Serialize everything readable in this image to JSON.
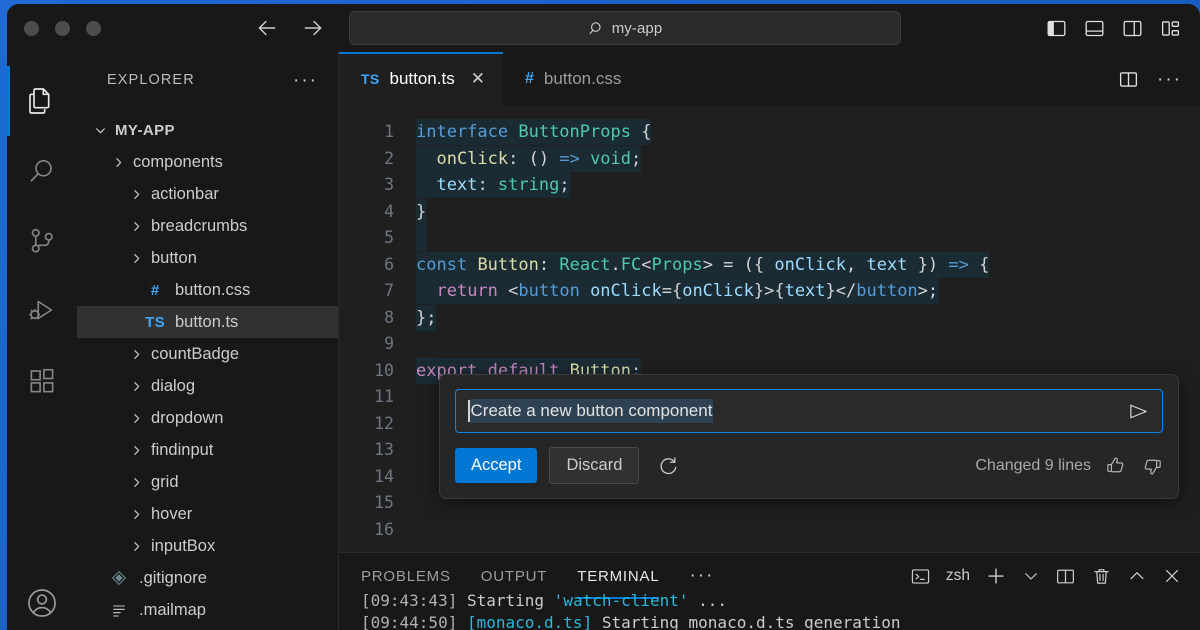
{
  "window": {
    "traffic_lights": [
      "close",
      "minimize",
      "maximize"
    ],
    "command_center": {
      "text": "my-app",
      "icon": "search-icon"
    },
    "nav": {
      "back": "back-arrow-icon",
      "forward": "forward-arrow-icon"
    },
    "layout_controls": [
      {
        "name": "toggle-primary-sidebar",
        "icon": "layout-sidebar-left-icon"
      },
      {
        "name": "toggle-panel",
        "icon": "layout-panel-icon"
      },
      {
        "name": "toggle-secondary-sidebar",
        "icon": "layout-sidebar-right-icon"
      },
      {
        "name": "customize-layout",
        "icon": "layout-customize-icon"
      }
    ]
  },
  "activity_bar": {
    "items": [
      {
        "name": "explorer",
        "icon": "files-icon",
        "active": true
      },
      {
        "name": "search",
        "icon": "search-icon",
        "active": false
      },
      {
        "name": "source-control",
        "icon": "source-control-icon",
        "active": false
      },
      {
        "name": "run-and-debug",
        "icon": "run-debug-icon",
        "active": false
      },
      {
        "name": "extensions",
        "icon": "extensions-icon",
        "active": false
      }
    ],
    "account": {
      "name": "accounts",
      "icon": "account-icon"
    }
  },
  "sidebar": {
    "title": "EXPLORER",
    "more_actions": "···",
    "tree": [
      {
        "label": "MY-APP",
        "kind": "root",
        "depth": 0,
        "expanded": true,
        "selected": false
      },
      {
        "label": "components",
        "kind": "folder",
        "depth": 1,
        "expanded": false,
        "selected": false
      },
      {
        "label": "actionbar",
        "kind": "folder",
        "depth": 2,
        "expanded": false,
        "selected": false
      },
      {
        "label": "breadcrumbs",
        "kind": "folder",
        "depth": 2,
        "expanded": false,
        "selected": false
      },
      {
        "label": "button",
        "kind": "folder",
        "depth": 2,
        "expanded": false,
        "selected": false
      },
      {
        "label": "button.css",
        "kind": "css",
        "depth": 3,
        "badge": "#",
        "selected": false
      },
      {
        "label": "button.ts",
        "kind": "ts",
        "depth": 3,
        "badge": "TS",
        "selected": true
      },
      {
        "label": "countBadge",
        "kind": "folder",
        "depth": 2,
        "expanded": false,
        "selected": false
      },
      {
        "label": "dialog",
        "kind": "folder",
        "depth": 2,
        "expanded": false,
        "selected": false
      },
      {
        "label": "dropdown",
        "kind": "folder",
        "depth": 2,
        "expanded": false,
        "selected": false
      },
      {
        "label": "findinput",
        "kind": "folder",
        "depth": 2,
        "expanded": false,
        "selected": false
      },
      {
        "label": "grid",
        "kind": "folder",
        "depth": 2,
        "expanded": false,
        "selected": false
      },
      {
        "label": "hover",
        "kind": "folder",
        "depth": 2,
        "expanded": false,
        "selected": false
      },
      {
        "label": "inputBox",
        "kind": "folder",
        "depth": 2,
        "expanded": false,
        "selected": false
      },
      {
        "label": ".gitignore",
        "kind": "git",
        "depth": 1,
        "selected": false
      },
      {
        "label": ".mailmap",
        "kind": "text",
        "depth": 1,
        "selected": false
      }
    ]
  },
  "editor": {
    "tabs": [
      {
        "label": "button.ts",
        "badge": "TS",
        "active": true,
        "closable": true,
        "close_glyph": "✕"
      },
      {
        "label": "button.css",
        "badge": "#",
        "active": false,
        "closable": false
      }
    ],
    "actions": [
      {
        "name": "split-editor",
        "icon": "split-editor-icon"
      },
      {
        "name": "more-actions",
        "icon": "ellipsis-icon",
        "glyph": "···"
      }
    ],
    "language": "typescript",
    "lines": [
      {
        "num": "1",
        "changed": true,
        "tokens": [
          {
            "t": "interface ",
            "c": "kw2"
          },
          {
            "t": "ButtonProps",
            "c": "type"
          },
          {
            "t": " {",
            "c": "pl"
          }
        ]
      },
      {
        "num": "2",
        "changed": true,
        "tokens": [
          {
            "t": "  ",
            "c": "pl"
          },
          {
            "t": "onClick",
            "c": "fn"
          },
          {
            "t": ": () ",
            "c": "pl"
          },
          {
            "t": "=>",
            "c": "kw2"
          },
          {
            "t": " ",
            "c": "pl"
          },
          {
            "t": "void",
            "c": "type"
          },
          {
            "t": ";",
            "c": "pl"
          }
        ]
      },
      {
        "num": "3",
        "changed": true,
        "tokens": [
          {
            "t": "  ",
            "c": "pl"
          },
          {
            "t": "text",
            "c": "var"
          },
          {
            "t": ": ",
            "c": "pl"
          },
          {
            "t": "string",
            "c": "type"
          },
          {
            "t": ";",
            "c": "pl"
          }
        ]
      },
      {
        "num": "4",
        "changed": true,
        "tokens": [
          {
            "t": "}",
            "c": "pl"
          }
        ]
      },
      {
        "num": "5",
        "changed": true,
        "tokens": []
      },
      {
        "num": "6",
        "changed": true,
        "tokens": [
          {
            "t": "const",
            "c": "kw2"
          },
          {
            "t": " ",
            "c": "pl"
          },
          {
            "t": "Button",
            "c": "fn"
          },
          {
            "t": ": ",
            "c": "pl"
          },
          {
            "t": "React",
            "c": "type"
          },
          {
            "t": ".",
            "c": "pl"
          },
          {
            "t": "FC",
            "c": "type"
          },
          {
            "t": "<",
            "c": "pl"
          },
          {
            "t": "Props",
            "c": "type"
          },
          {
            "t": "> = ({ ",
            "c": "pl"
          },
          {
            "t": "onClick",
            "c": "var"
          },
          {
            "t": ", ",
            "c": "pl"
          },
          {
            "t": "text",
            "c": "var"
          },
          {
            "t": " }) ",
            "c": "pl"
          },
          {
            "t": "=>",
            "c": "kw2"
          },
          {
            "t": " {",
            "c": "pl"
          }
        ]
      },
      {
        "num": "7",
        "changed": true,
        "tokens": [
          {
            "t": "  ",
            "c": "pl"
          },
          {
            "t": "return",
            "c": "kw"
          },
          {
            "t": " <",
            "c": "pl"
          },
          {
            "t": "button",
            "c": "tag"
          },
          {
            "t": " ",
            "c": "pl"
          },
          {
            "t": "onClick",
            "c": "var"
          },
          {
            "t": "={",
            "c": "pl"
          },
          {
            "t": "onClick",
            "c": "var"
          },
          {
            "t": "}>{",
            "c": "pl"
          },
          {
            "t": "text",
            "c": "var"
          },
          {
            "t": "}</",
            "c": "pl"
          },
          {
            "t": "button",
            "c": "tag"
          },
          {
            "t": ">;",
            "c": "pl"
          }
        ]
      },
      {
        "num": "8",
        "changed": true,
        "tokens": [
          {
            "t": "};",
            "c": "pl"
          }
        ]
      },
      {
        "num": "9",
        "changed": false,
        "tokens": []
      },
      {
        "num": "10",
        "changed": true,
        "tokens": [
          {
            "t": "export",
            "c": "kw"
          },
          {
            "t": " ",
            "c": "pl"
          },
          {
            "t": "default",
            "c": "kw"
          },
          {
            "t": " ",
            "c": "pl"
          },
          {
            "t": "Button",
            "c": "fn"
          },
          {
            "t": ";",
            "c": "pl"
          }
        ]
      },
      {
        "num": "11",
        "changed": false,
        "tokens": []
      },
      {
        "num": "12",
        "changed": false,
        "tokens": []
      },
      {
        "num": "13",
        "changed": false,
        "tokens": []
      },
      {
        "num": "14",
        "changed": false,
        "tokens": []
      },
      {
        "num": "15",
        "changed": false,
        "tokens": []
      },
      {
        "num": "16",
        "changed": false,
        "tokens": []
      }
    ],
    "gutter_numbers": [
      "1",
      "2",
      "3",
      "4",
      "5",
      "6",
      "7",
      "8",
      "9",
      "10",
      "11",
      "12",
      "13",
      "14",
      "15"
    ]
  },
  "inline_chat": {
    "input_value": "Create a new button component",
    "input_selected": true,
    "send_icon": "send-icon",
    "accept_label": "Accept",
    "discard_label": "Discard",
    "rerun_icon": "refresh-icon",
    "status": "Changed 9 lines",
    "thumbs_up_icon": "thumbs-up-icon",
    "thumbs_down_icon": "thumbs-down-icon",
    "accent_color": "#0078d4"
  },
  "panel": {
    "tabs": [
      {
        "label": "PROBLEMS",
        "active": false
      },
      {
        "label": "OUTPUT",
        "active": false
      },
      {
        "label": "TERMINAL",
        "active": true
      }
    ],
    "more_glyph": "···",
    "shell": "zsh",
    "actions": [
      {
        "name": "terminal-shell",
        "icon": "terminal-icon"
      },
      {
        "name": "new-terminal",
        "icon": "plus-icon",
        "glyph": "+"
      },
      {
        "name": "terminal-dropdown",
        "icon": "chevron-down-icon"
      },
      {
        "name": "split-terminal",
        "icon": "split-terminal-icon"
      },
      {
        "name": "kill-terminal",
        "icon": "trash-icon"
      },
      {
        "name": "maximize-panel",
        "icon": "chevron-up-icon"
      },
      {
        "name": "close-panel",
        "icon": "close-icon",
        "glyph": "✕"
      }
    ],
    "terminal_lines": [
      {
        "segments": [
          {
            "t": "[09:43:43] ",
            "c": "dim"
          },
          {
            "t": "Starting ",
            "c": "normal"
          },
          {
            "t": "'watch-client'",
            "c": "cyan"
          },
          {
            "t": " ...",
            "c": "normal"
          }
        ]
      },
      {
        "segments": [
          {
            "t": "[09:44:50] ",
            "c": "dim"
          },
          {
            "t": "[monaco.d.ts]",
            "c": "cyan"
          },
          {
            "t": " Starting monaco.d.ts generation",
            "c": "normal"
          }
        ]
      }
    ]
  }
}
